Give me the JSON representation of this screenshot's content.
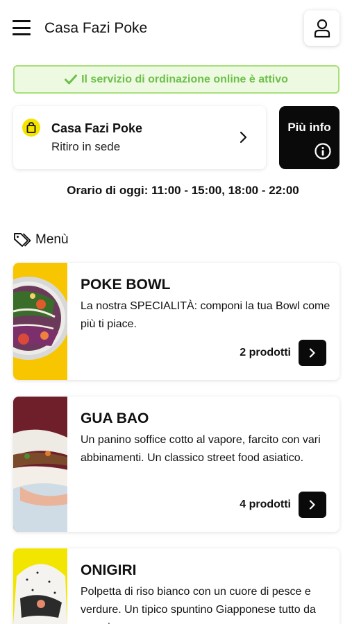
{
  "header": {
    "title": "Casa Fazi Poke",
    "menu_icon": "hamburger-menu-icon",
    "user_icon": "user-icon"
  },
  "status": {
    "text": "Il servizio di ordinazione online è attivo",
    "icon": "check-icon",
    "color": "#6cc04a"
  },
  "shop": {
    "name": "Casa Fazi Poke",
    "mode": "Ritiro in sede",
    "icon": "shopping-bag-icon",
    "accent": "#f5e400"
  },
  "info_button": {
    "label": "Più info",
    "icon": "info-icon"
  },
  "hours": {
    "text": "Orario di oggi: 11:00 - 15:00, 18:00 - 22:00"
  },
  "menu": {
    "heading": "Menù",
    "heading_icon": "tag-icon",
    "categories": [
      {
        "title": "POKE BOWL",
        "description": "La nostra SPECIALITÀ: componi la tua Bowl come più ti piace.",
        "count": "2 prodotti"
      },
      {
        "title": "GUA BAO",
        "description": "Un panino soffice cotto al vapore, farcito con vari abbinamenti. Un classico street food asiatico.",
        "count": "4 prodotti"
      },
      {
        "title": "ONIGIRI",
        "description": "Polpetta di riso bianco con un cuore di pesce e verdure. Un tipico spuntino Giapponese tutto da scoprire.",
        "count": ""
      }
    ]
  }
}
